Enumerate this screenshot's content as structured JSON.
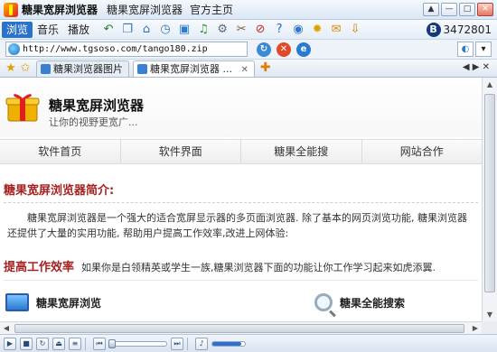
{
  "window": {
    "title": "糖果宽屏浏览器",
    "menus": [
      "糖果宽屏浏览器",
      "官方主页"
    ],
    "controls": [
      "▲",
      "—",
      "□",
      "✕"
    ]
  },
  "toolbar": {
    "tabs": [
      "浏览",
      "音乐",
      "播放"
    ],
    "active_tab": "浏览",
    "icons": [
      "back-icon",
      "copy-icon",
      "home-icon",
      "history-icon",
      "screen-icon",
      "music-note-icon",
      "gear-icon",
      "tools-icon",
      "cancel-icon",
      "help-icon",
      "earth-icon",
      "bulb-icon",
      "chat-icon",
      "download-icon"
    ],
    "user_id": "3472801",
    "user_badge": "B"
  },
  "address": {
    "url": "http://www.tgsoso.com/tango180.zip",
    "actions": [
      "refresh-icon",
      "stop-icon",
      "ie-icon"
    ]
  },
  "tabs": {
    "items": [
      {
        "label": "糖果浏览器图片"
      },
      {
        "label": "糖果宽屏浏览器 ..."
      }
    ],
    "active_index": 1,
    "new_tab": "✚",
    "controls": "◀ ▶ ✕"
  },
  "page": {
    "site_title": "糖果宽屏浏览器",
    "site_subtitle": "让你的视野更宽广...",
    "nav": [
      "软件首页",
      "软件界面",
      "糖果全能搜",
      "网站合作"
    ],
    "intro_title": "糖果宽屏浏览器简介:",
    "intro_text": "糖果宽屏浏览器是一个强大的适合宽屏显示器的多页面浏览器. 除了基本的网页浏览功能, 糖果浏览器还提供了大量的实用功能, 帮助用户提高工作效率,改进上网体验:",
    "feature_title": "提高工作效率",
    "feature_desc": "如果你是白领精英或学生一族,糖果浏览器下面的功能让你工作学习起来如虎添翼.",
    "features": [
      "糖果宽屏浏览",
      "糖果全能搜索"
    ]
  },
  "media": {
    "seek_progress": 0.0,
    "volume_level": 0.9
  },
  "colors": {
    "accent": "#2b73c8",
    "heading_red": "#a52222"
  }
}
